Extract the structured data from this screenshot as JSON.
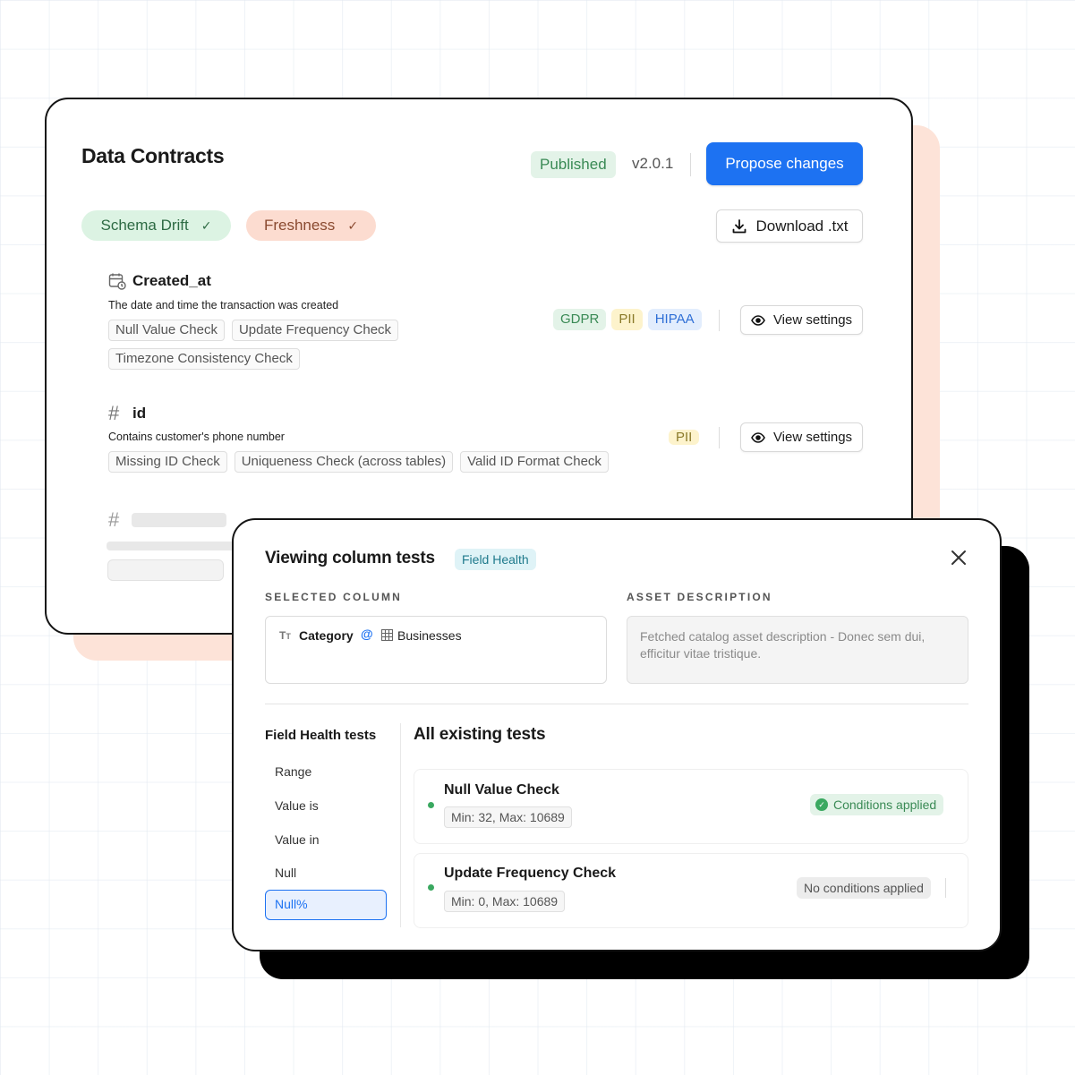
{
  "contract": {
    "title": "Data Contracts",
    "status": "Published",
    "version": "v2.0.1",
    "propose_label": "Propose changes",
    "download_label": "Download .txt",
    "pills": [
      {
        "label": "Schema Drift",
        "color": "#dcf3e3"
      },
      {
        "label": "Freshness",
        "color": "#fcdcd0"
      }
    ],
    "fields": [
      {
        "icon": "calendar-clock-icon",
        "name": "Created_at",
        "description": "The date and time the transaction was created",
        "checks": [
          "Null Value Check",
          "Update Frequency Check",
          "Timezone Consistency Check"
        ],
        "tags": [
          "GDPR",
          "PII",
          "HIPAA"
        ],
        "action_label": "View settings"
      },
      {
        "icon": "hash-icon",
        "name": "id",
        "description": "Contains customer's phone number",
        "checks": [
          "Missing ID Check",
          "Uniqueness Check (across tables)",
          "Valid ID Format Check"
        ],
        "tags": [
          "PII"
        ],
        "action_label": "View settings"
      }
    ]
  },
  "modal": {
    "title": "Viewing column tests",
    "badge": "Field Health",
    "selected_column_label": "SELECTED COLUMN",
    "asset_description_label": "ASSET DESCRIPTION",
    "column_name": "Category",
    "column_table": "Businesses",
    "asset_description": "Fetched catalog asset description - Donec sem dui, efficitur vitae tristique.",
    "sidebar_title": "Field Health tests",
    "sidebar_items": [
      "Range",
      "Value is",
      "Value in",
      "Null",
      "Null%"
    ],
    "active_item": "Null%",
    "tests_title": "All existing tests",
    "tests": [
      {
        "name": "Null Value Check",
        "range": "Min: 32, Max: 10689",
        "status": "Conditions applied"
      },
      {
        "name": "Update Frequency Check",
        "range": "Min: 0, Max: 10689",
        "status": "No conditions applied"
      }
    ]
  },
  "colors": {
    "accent": "#1d72f2",
    "success": "#3aa860",
    "peach": "#fde3d8"
  }
}
